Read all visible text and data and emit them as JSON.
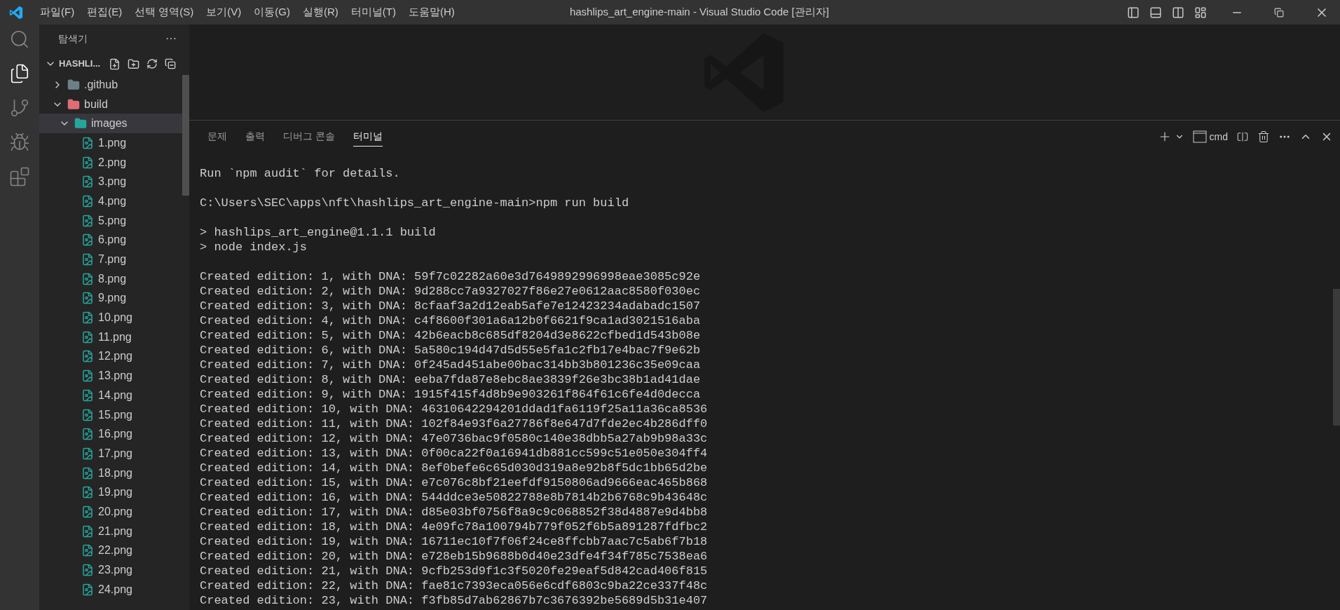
{
  "menu": [
    "파일(F)",
    "편집(E)",
    "선택 영역(S)",
    "보기(V)",
    "이동(G)",
    "실행(R)",
    "터미널(T)",
    "도움말(H)"
  ],
  "window": {
    "title": "hashlips_art_engine-main - Visual Studio Code [관리자]"
  },
  "activity_bar": [
    {
      "kind": "search",
      "selected": false
    },
    {
      "kind": "files",
      "selected": true
    },
    {
      "kind": "source-control",
      "selected": false
    },
    {
      "kind": "run-debug",
      "selected": false
    },
    {
      "kind": "extensions",
      "selected": false
    }
  ],
  "sidebar": {
    "title": "탐색기",
    "more": "···",
    "project": "HASHLI...",
    "tree": [
      {
        "name": ".github",
        "kind": "github-folder",
        "expanded": false,
        "selected": false
      },
      {
        "name": "build",
        "kind": "folder",
        "expanded": true,
        "selected": false,
        "children": [
          {
            "name": "images",
            "kind": "images-folder",
            "expanded": true,
            "selected": true,
            "children": [
              {
                "name": "1.png",
                "kind": "image",
                "selected": false
              },
              {
                "name": "2.png",
                "kind": "image",
                "selected": false
              },
              {
                "name": "3.png",
                "kind": "image",
                "selected": false
              },
              {
                "name": "4.png",
                "kind": "image",
                "selected": false
              },
              {
                "name": "5.png",
                "kind": "image",
                "selected": false
              },
              {
                "name": "6.png",
                "kind": "image",
                "selected": false
              },
              {
                "name": "7.png",
                "kind": "image",
                "selected": false
              },
              {
                "name": "8.png",
                "kind": "image",
                "selected": false
              },
              {
                "name": "9.png",
                "kind": "image",
                "selected": false
              },
              {
                "name": "10.png",
                "kind": "image",
                "selected": false
              },
              {
                "name": "11.png",
                "kind": "image",
                "selected": false
              },
              {
                "name": "12.png",
                "kind": "image",
                "selected": false
              },
              {
                "name": "13.png",
                "kind": "image",
                "selected": false
              },
              {
                "name": "14.png",
                "kind": "image",
                "selected": false
              },
              {
                "name": "15.png",
                "kind": "image",
                "selected": false
              },
              {
                "name": "16.png",
                "kind": "image",
                "selected": false
              },
              {
                "name": "17.png",
                "kind": "image",
                "selected": false
              },
              {
                "name": "18.png",
                "kind": "image",
                "selected": false
              },
              {
                "name": "19.png",
                "kind": "image",
                "selected": false
              },
              {
                "name": "20.png",
                "kind": "image",
                "selected": false
              },
              {
                "name": "21.png",
                "kind": "image",
                "selected": false
              },
              {
                "name": "22.png",
                "kind": "image",
                "selected": false
              },
              {
                "name": "23.png",
                "kind": "image",
                "selected": false
              },
              {
                "name": "24.png",
                "kind": "image",
                "selected": false
              }
            ]
          }
        ]
      }
    ]
  },
  "panel": {
    "tabs": [
      {
        "label": "문제",
        "selected": false
      },
      {
        "label": "출력",
        "selected": false
      },
      {
        "label": "디버그 콘솔",
        "selected": false
      },
      {
        "label": "터미널",
        "selected": true
      }
    ],
    "terminal_name": "cmd",
    "blocks": [
      [
        "Run `npm audit` for details."
      ],
      [
        "C:\\Users\\SEC\\apps\\nft\\hashlips_art_engine-main>npm run build"
      ],
      [
        "> hashlips_art_engine@1.1.1 build",
        "> node index.js"
      ],
      [
        "Created edition: 1, with DNA: 59f7c02282a60e3d7649892996998eae3085c92e",
        "Created edition: 2, with DNA: 9d288cc7a9327027f86e27e0612aac8580f030ec",
        "Created edition: 3, with DNA: 8cfaaf3a2d12eab5afe7e12423234adabadc1507",
        "Created edition: 4, with DNA: c4f8600f301a6a12b0f6621f9ca1ad3021516aba",
        "Created edition: 5, with DNA: 42b6eacb8c685df8204d3e8622cfbed1d543b08e",
        "Created edition: 6, with DNA: 5a580c194d47d5d55e5fa1c2fb17e4bac7f9e62b",
        "Created edition: 7, with DNA: 0f245ad451abe00bac314bb3b801236c35e09caa",
        "Created edition: 8, with DNA: eeba7fda87e8ebc8ae3839f26e3bc38b1ad41dae",
        "Created edition: 9, with DNA: 1915f415f4d8b9e903261f864f61c6fe4d0decca",
        "Created edition: 10, with DNA: 46310642294201ddad1fa6119f25a11a36ca8536",
        "Created edition: 11, with DNA: 102f84e93f6a27786f8e647d7fde2ec4b286dff0",
        "Created edition: 12, with DNA: 47e0736bac9f0580c140e38dbb5a27ab9b98a33c",
        "Created edition: 13, with DNA: 0f00ca22f0a16941db881cc599c51e050e304ff4",
        "Created edition: 14, with DNA: 8ef0befe6c65d030d319a8e92b8f5dc1bb65d2be",
        "Created edition: 15, with DNA: e7c076c8bf21eefdf9150806ad9666eac465b868",
        "Created edition: 16, with DNA: 544ddce3e50822788e8b7814b2b6768c9b43648c",
        "Created edition: 17, with DNA: d85e03bf0756f8a9c9c068852f38d4887e9d4bb8",
        "Created edition: 18, with DNA: 4e09fc78a100794b779f052f6b5a891287fdfbc2",
        "Created edition: 19, with DNA: 16711ec10f7f06f24ce8ffcbb7aac7c5ab6f7b18",
        "Created edition: 20, with DNA: e728eb15b9688b0d40e23dfe4f34f785c7538ea6",
        "Created edition: 21, with DNA: 9cfb253d9f1c3f5020fe29eaf5d842cad406f815",
        "Created edition: 22, with DNA: fae81c7393eca056e6cdf6803c9ba22ce337f48c",
        "Created edition: 23, with DNA: f3fb85d7ab62867b7c3676392be5689d5b31e407"
      ]
    ]
  }
}
